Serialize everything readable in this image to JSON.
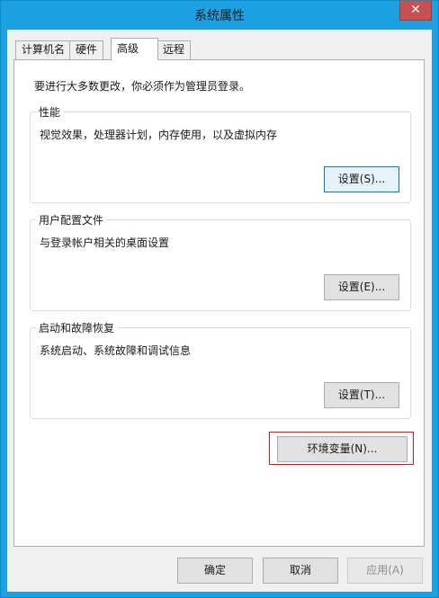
{
  "window": {
    "title": "系统属性",
    "close_label": "✕"
  },
  "tabs": [
    {
      "label": "计算机名",
      "active": false
    },
    {
      "label": "硬件",
      "active": false
    },
    {
      "label": "高级",
      "active": true
    },
    {
      "label": "远程",
      "active": false
    }
  ],
  "advanced": {
    "intro": "要进行大多数更改，你必须作为管理员登录。",
    "performance": {
      "title": "性能",
      "description": "视觉效果，处理器计划，内存使用，以及虚拟内存",
      "button": "设置(S)..."
    },
    "user_profiles": {
      "title": "用户配置文件",
      "description": "与登录帐户相关的桌面设置",
      "button": "设置(E)..."
    },
    "startup_recovery": {
      "title": "启动和故障恢复",
      "description": "系统启动、系统故障和调试信息",
      "button": "设置(T)..."
    },
    "env_button": "环境变量(N)..."
  },
  "footer": {
    "ok": "确定",
    "cancel": "取消",
    "apply": "应用(A)"
  },
  "colors": {
    "titlebar": "#1ba1e2",
    "close": "#c75050",
    "highlight_box": "#e51400",
    "focus": "#0078d7"
  }
}
